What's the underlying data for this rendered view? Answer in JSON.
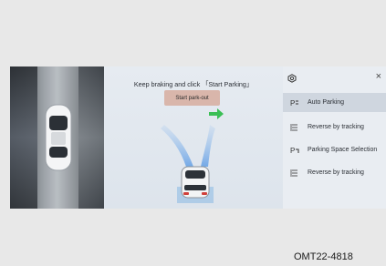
{
  "screen": {
    "instruction": "Keep braking and click 「Start Parking」",
    "start_button_label": "Start park-out"
  },
  "menu": {
    "items": [
      {
        "label": "Auto Parking",
        "icon": "auto-parking-icon",
        "selected": true
      },
      {
        "label": "Reverse by tracking",
        "icon": "reverse-tracking-icon",
        "selected": false
      },
      {
        "label": "Parking Space Selection",
        "icon": "parking-space-icon",
        "selected": false
      },
      {
        "label": "Reverse by tracking",
        "icon": "reverse-tracking-icon",
        "selected": false
      }
    ]
  },
  "caption": "OMT22-4818",
  "colors": {
    "start_button": "#d9b6ab",
    "arrow": "#3bbf55",
    "trajectory": "#7fb0e8"
  }
}
